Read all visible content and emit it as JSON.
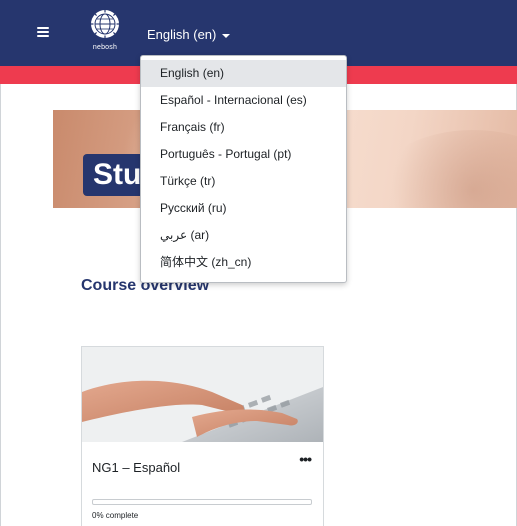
{
  "navbar": {
    "logo_text": "nebosh",
    "language_toggle": "English (en)"
  },
  "banner": {
    "title": "Stu"
  },
  "language_menu": {
    "items": [
      "English (en)",
      "Español - Internacional (es)",
      "Français (fr)",
      "Português - Portugal (pt)",
      "Türkçe (tr)",
      "Русский (ru)",
      "عربي (ar)",
      "简体中文 (zh_cn)"
    ],
    "selected_index": 0
  },
  "course_overview": {
    "title": "Course overview",
    "card": {
      "course_name": "NG1 – Español",
      "menu_glyph": "•••",
      "progress_text": "0% complete",
      "progress_percent": 0
    }
  },
  "colors": {
    "navbar": "#26366e",
    "accent_strip": "#ee3b4f",
    "heading": "#26366e"
  },
  "icons": [
    "hamburger-icon",
    "nebosh-logo-icon",
    "caret-down-icon",
    "more-options-icon"
  ]
}
